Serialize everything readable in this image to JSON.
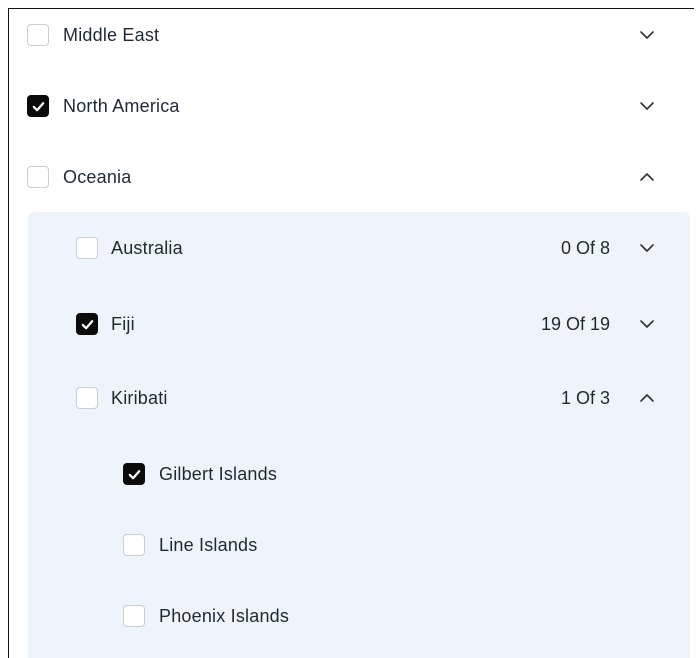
{
  "regions": [
    {
      "label": "Middle East",
      "checked": false,
      "expanded": false
    },
    {
      "label": "North America",
      "checked": true,
      "expanded": false
    },
    {
      "label": "Oceania",
      "checked": false,
      "expanded": true
    }
  ],
  "countries": [
    {
      "label": "Australia",
      "checked": false,
      "count": "0 Of 8",
      "expanded": false
    },
    {
      "label": "Fiji",
      "checked": true,
      "count": "19 Of 19",
      "expanded": false
    },
    {
      "label": "Kiribati",
      "checked": false,
      "count": "1 Of 3",
      "expanded": true
    }
  ],
  "subregions": [
    {
      "label": "Gilbert Islands",
      "checked": true
    },
    {
      "label": "Line Islands",
      "checked": false
    },
    {
      "label": "Phoenix Islands",
      "checked": false
    }
  ],
  "colors": {
    "checked": "#0b0b0b",
    "panel": "#eef4fb",
    "border": "#c9ced6"
  },
  "icons": {
    "check": "check-icon",
    "expand": "chevron-down-icon",
    "collapse": "chevron-up-icon"
  }
}
